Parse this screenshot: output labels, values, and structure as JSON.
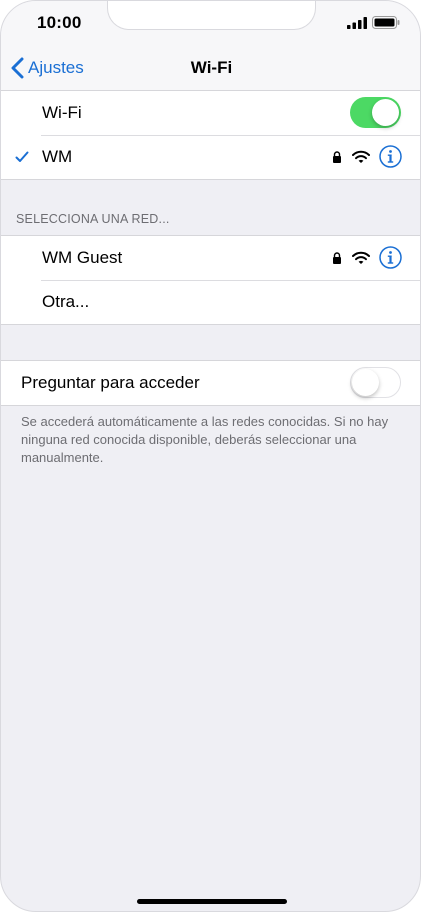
{
  "status_bar": {
    "time": "10:00"
  },
  "nav": {
    "back_label": "Ajustes",
    "title": "Wi-Fi"
  },
  "wifi_group": {
    "wifi_label": "Wi-Fi",
    "wifi_enabled": true,
    "connected_network": "WM"
  },
  "networks": {
    "header": "SELECCIONA UNA RED...",
    "items": [
      {
        "name": "WM Guest",
        "secured": true
      },
      {
        "name": "Otra..."
      }
    ]
  },
  "ask_join": {
    "label": "Preguntar para acceder",
    "enabled": false,
    "footer": "Se accederá automáticamente a las redes conocidas. Si no hay ninguna red conocida disponible, deberás seleccionar una manualmente."
  },
  "colors": {
    "accent": "#1a6fd4",
    "toggle_on": "#4cd964",
    "background": "#efeff4"
  },
  "icons": {
    "check": "checkmark-icon",
    "lock": "lock-icon",
    "wifi": "wifi-signal-icon",
    "info": "info-icon",
    "back": "chevron-left-icon"
  }
}
